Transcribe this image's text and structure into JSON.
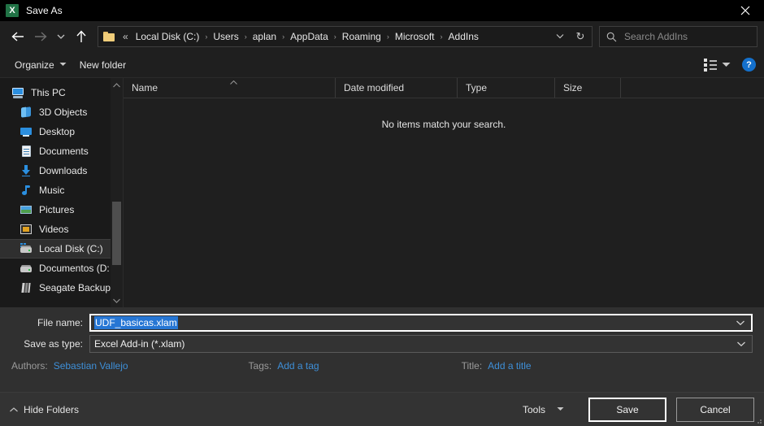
{
  "window": {
    "title": "Save As",
    "app_icon": "excel-icon",
    "close_label": "✕"
  },
  "nav": {
    "back_icon": "back-arrow-icon",
    "forward_icon": "forward-arrow-icon",
    "recent_icon": "chevron-down-icon",
    "up_icon": "up-arrow-icon",
    "breadcrumb": {
      "folder_icon": "folder-icon",
      "overflow": "«",
      "separator": "›",
      "items": [
        "Local Disk (C:)",
        "Users",
        "aplan",
        "AppData",
        "Roaming",
        "Microsoft",
        "AddIns"
      ],
      "dropdown_icon": "chevron-down-icon",
      "refresh_icon": "refresh-icon",
      "refresh_glyph": "↻"
    },
    "search": {
      "icon": "search-icon",
      "placeholder": "Search AddIns",
      "value": ""
    }
  },
  "toolbar": {
    "organize_label": "Organize",
    "new_folder_label": "New folder",
    "view_icon": "view-layout-icon",
    "view_caret_icon": "chevron-down-icon",
    "help_label": "?"
  },
  "sidebar": {
    "items": [
      {
        "label": "This PC",
        "icon": "computer-icon",
        "indent": false,
        "selected": false
      },
      {
        "label": "3D Objects",
        "icon": "3d-objects-icon",
        "indent": true,
        "selected": false
      },
      {
        "label": "Desktop",
        "icon": "desktop-icon",
        "indent": true,
        "selected": false
      },
      {
        "label": "Documents",
        "icon": "documents-icon",
        "indent": true,
        "selected": false
      },
      {
        "label": "Downloads",
        "icon": "downloads-icon",
        "indent": true,
        "selected": false
      },
      {
        "label": "Music",
        "icon": "music-icon",
        "indent": true,
        "selected": false
      },
      {
        "label": "Pictures",
        "icon": "pictures-icon",
        "indent": true,
        "selected": false
      },
      {
        "label": "Videos",
        "icon": "videos-icon",
        "indent": true,
        "selected": false
      },
      {
        "label": "Local Disk (C:)",
        "icon": "drive-icon",
        "indent": true,
        "selected": true
      },
      {
        "label": "Documentos (D:",
        "icon": "drive-icon",
        "indent": true,
        "selected": false
      },
      {
        "label": "Seagate Backup",
        "icon": "external-drive-icon",
        "indent": true,
        "selected": false
      }
    ],
    "scroll_up_icon": "chevron-up-icon",
    "scroll_down_icon": "chevron-down-icon"
  },
  "filelist": {
    "columns": [
      {
        "label": "Name"
      },
      {
        "label": "Date modified"
      },
      {
        "label": "Type"
      },
      {
        "label": "Size"
      }
    ],
    "sort_indicator": "ascending-sort-icon",
    "empty_message": "No items match your search.",
    "rows": []
  },
  "form": {
    "filename_label": "File name:",
    "filename_value": "UDF_basicas.xlam",
    "filename_selected": true,
    "savetype_label": "Save as type:",
    "savetype_value": "Excel Add-in (*.xlam)",
    "dropdown_icon": "chevron-down-icon",
    "meta": {
      "authors_label": "Authors:",
      "authors_value": "Sebastian Vallejo",
      "tags_label": "Tags:",
      "tags_value": "Add a tag",
      "title_label": "Title:",
      "title_value": "Add a title"
    }
  },
  "footer": {
    "hide_folders_label": "Hide Folders",
    "hide_folders_icon": "chevron-up-icon",
    "tools_label": "Tools",
    "tools_caret_icon": "chevron-down-icon",
    "save_label": "Save",
    "cancel_label": "Cancel"
  },
  "colors": {
    "accent": "#2676d4",
    "link": "#3e8fd8",
    "help_blue": "#1470cc",
    "excel_green": "#217346",
    "dialog_bg": "#1f1f1f",
    "form_bg": "#303030",
    "footer_bg": "#333333"
  }
}
